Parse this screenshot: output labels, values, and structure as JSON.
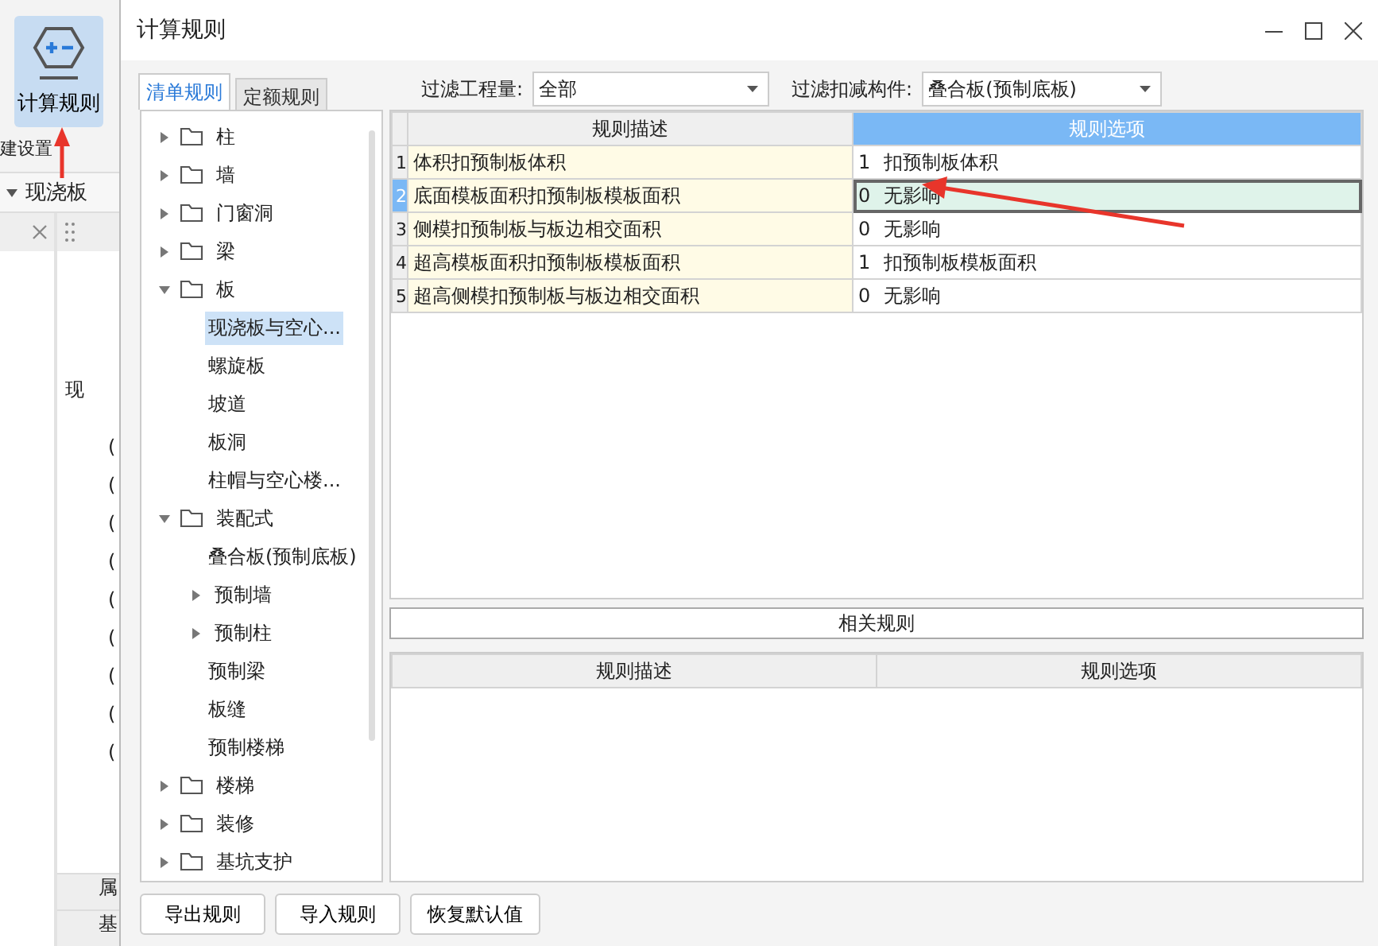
{
  "background_app": {
    "ribbon_button": "计算规则",
    "settings_label": "建设置",
    "dropdown": "现浇板",
    "tree_fragment": "现",
    "paren_marks": [
      "(",
      "(",
      "(",
      "(",
      "(",
      "(",
      "(",
      "(",
      "("
    ],
    "bottom_fragments": [
      "属",
      "基"
    ]
  },
  "dialog": {
    "title": "计算规则",
    "tabs": [
      {
        "label": "清单规则",
        "selected": true
      },
      {
        "label": "定额规则",
        "selected": false
      }
    ],
    "filters": [
      {
        "label": "过滤工程量:",
        "value": "全部"
      },
      {
        "label": "过滤扣减构件:",
        "value": "叠合板(预制底板)"
      }
    ],
    "tree": [
      {
        "label": "柱",
        "kind": "folder",
        "expanded": false,
        "selected": false
      },
      {
        "label": "墙",
        "kind": "folder",
        "expanded": false,
        "selected": false
      },
      {
        "label": "门窗洞",
        "kind": "folder",
        "expanded": false,
        "selected": false
      },
      {
        "label": "梁",
        "kind": "folder",
        "expanded": false,
        "selected": false
      },
      {
        "label": "板",
        "kind": "folder",
        "expanded": true,
        "selected": false,
        "children": [
          {
            "label": "现浇板与空心...",
            "selected": true
          },
          {
            "label": "螺旋板",
            "selected": false
          },
          {
            "label": "坡道",
            "selected": false
          },
          {
            "label": "板洞",
            "selected": false
          },
          {
            "label": "柱帽与空心楼...",
            "selected": false
          }
        ]
      },
      {
        "label": "装配式",
        "kind": "folder",
        "expanded": true,
        "selected": false,
        "children": [
          {
            "label": "叠合板(预制底板)",
            "selected": false
          },
          {
            "label": "预制墙",
            "expanded": false,
            "selected": false
          },
          {
            "label": "预制柱",
            "expanded": false,
            "selected": false
          },
          {
            "label": "预制梁",
            "selected": false
          },
          {
            "label": "板缝",
            "selected": false
          },
          {
            "label": "预制楼梯",
            "selected": false
          }
        ]
      },
      {
        "label": "楼梯",
        "kind": "folder",
        "expanded": false,
        "selected": false
      },
      {
        "label": "装修",
        "kind": "folder",
        "expanded": false,
        "selected": false
      },
      {
        "label": "基坑支护",
        "kind": "folder",
        "expanded": false,
        "selected": false
      }
    ],
    "rules_table": {
      "columns": [
        "规则描述",
        "规则选项"
      ],
      "rows": [
        {
          "number": "1",
          "description": "体积扣预制板体积",
          "option_code": "1",
          "option_text": "扣预制板体积",
          "selected": false
        },
        {
          "number": "2",
          "description": "底面模板面积扣预制板模板面积",
          "option_code": "0",
          "option_text": "无影响",
          "selected": true
        },
        {
          "number": "3",
          "description": "侧模扣预制板与板边相交面积",
          "option_code": "0",
          "option_text": "无影响",
          "selected": false
        },
        {
          "number": "4",
          "description": "超高模板面积扣预制板模板面积",
          "option_code": "1",
          "option_text": "扣预制板模板面积",
          "selected": false
        },
        {
          "number": "5",
          "description": "超高侧模扣预制板与板边相交面积",
          "option_code": "0",
          "option_text": "无影响",
          "selected": false
        }
      ]
    },
    "related_title": "相关规则",
    "related_table": {
      "columns": [
        "规则描述",
        "规则选项"
      ]
    },
    "buttons": [
      "导出规则",
      "导入规则",
      "恢复默认值"
    ]
  }
}
